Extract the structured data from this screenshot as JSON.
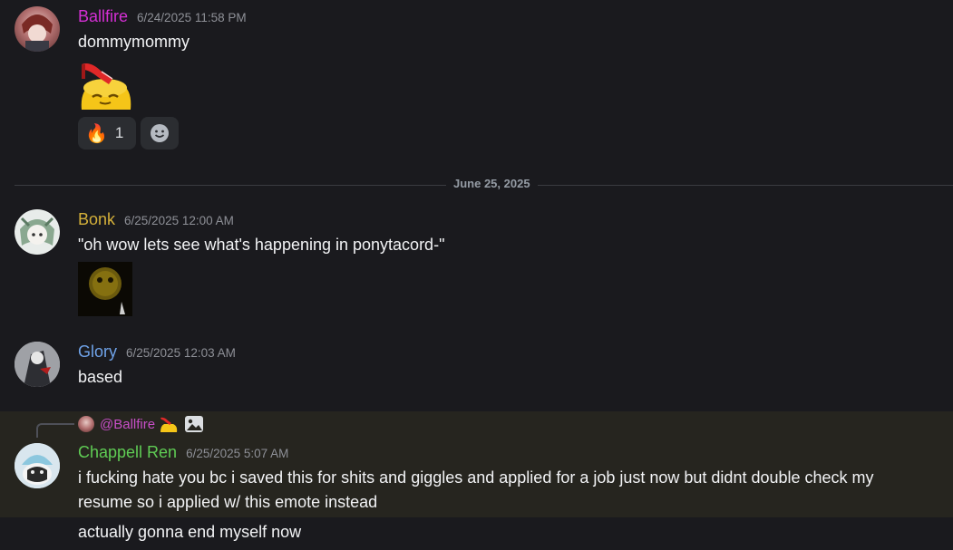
{
  "messages": [
    {
      "username": "Ballfire",
      "username_color": "#d42fd4",
      "timestamp": "6/24/2025 11:58 PM",
      "text": "dommymommy",
      "emoji": "heeled-blob-emote",
      "reactions": [
        {
          "emoji": "fire-icon",
          "count": "1"
        },
        {
          "emoji": "add-reaction-icon",
          "count": ""
        }
      ]
    },
    {
      "username": "Bonk",
      "username_color": "#d4b03a",
      "timestamp": "6/25/2025 12:00 AM",
      "text": "\"oh wow lets see what's happening in ponytacord-\"",
      "attachment": "dark-image-thumbnail"
    },
    {
      "username": "Glory",
      "username_color": "#6fa2e8",
      "timestamp": "6/25/2025 12:03 AM",
      "text": "based"
    },
    {
      "reply_to": "@Ballfire",
      "reply_color": "#c74fc7",
      "username": "Chappell Ren",
      "username_color": "#5fcc54",
      "timestamp": "6/25/2025 5:07 AM",
      "text_line1": "i fucking hate you bc i saved this for shits and giggles and applied for a job just now but didnt double check my",
      "text_line2": "resume so i applied w/ this emote instead",
      "followup": "actually gonna end myself now"
    }
  ],
  "divider": {
    "label": "June 25, 2025"
  }
}
